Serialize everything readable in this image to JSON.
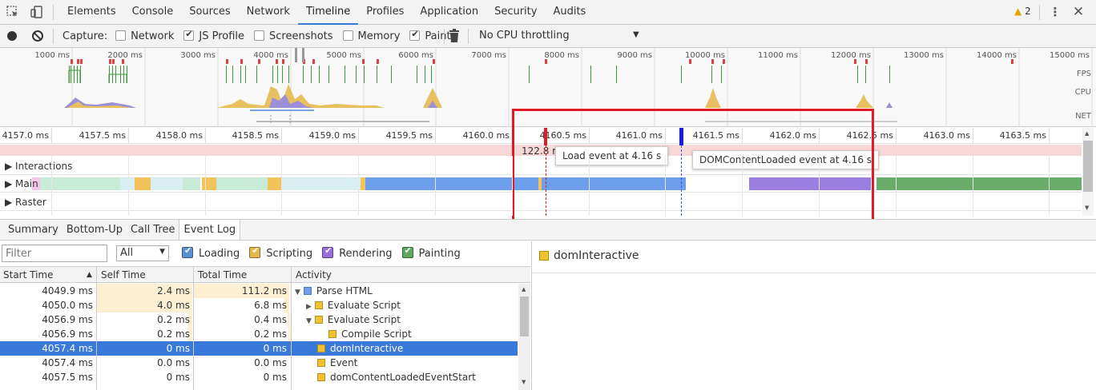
{
  "toolbar": {
    "tabs": [
      "Elements",
      "Console",
      "Sources",
      "Network",
      "Timeline",
      "Profiles",
      "Application",
      "Security",
      "Audits"
    ],
    "active_tab": "Timeline",
    "warning_count": "2"
  },
  "capture": {
    "label": "Capture:",
    "options": [
      {
        "label": "Network",
        "checked": false
      },
      {
        "label": "JS Profile",
        "checked": true
      },
      {
        "label": "Screenshots",
        "checked": false
      },
      {
        "label": "Memory",
        "checked": false
      },
      {
        "label": "Paint",
        "checked": true
      }
    ],
    "throttling": "No CPU throttling"
  },
  "overview": {
    "ticks": [
      "1000 ms",
      "2000 ms",
      "3000 ms",
      "4000 ms",
      "5000 ms",
      "6000 ms",
      "7000 ms",
      "8000 ms",
      "9000 ms",
      "10000 ms",
      "11000 ms",
      "12000 ms",
      "13000 ms",
      "14000 ms",
      "15000 ms"
    ],
    "lanes": [
      "FPS",
      "CPU",
      "NET"
    ]
  },
  "ruler": {
    "ticks": [
      "4157.0 ms",
      "4157.5 ms",
      "4158.0 ms",
      "4158.5 ms",
      "4159.0 ms",
      "4159.5 ms",
      "4160.0 ms",
      "4160.5 ms",
      "4161.0 ms",
      "4161.5 ms",
      "4162.0 ms",
      "4162.5 ms",
      "4163.0 ms",
      "4163.5 ms"
    ]
  },
  "flame": {
    "fragment_label": "122.8 m",
    "tracks": [
      "Interactions",
      "Main",
      "Raster"
    ],
    "load_tooltip": "Load event at 4.16 s",
    "dcl_tooltip": "DOMContentLoaded event at 4.16 s"
  },
  "bottom_tabs": {
    "tabs": [
      "Summary",
      "Bottom-Up",
      "Call Tree",
      "Event Log"
    ],
    "active": "Event Log"
  },
  "filters": {
    "placeholder": "Filter",
    "duration": "All",
    "categories": [
      {
        "label": "Loading",
        "color": "#5b8fd6"
      },
      {
        "label": "Scripting",
        "color": "#e6b84a"
      },
      {
        "label": "Rendering",
        "color": "#9a6fdb"
      },
      {
        "label": "Painting",
        "color": "#5fa760"
      }
    ]
  },
  "table": {
    "headers": [
      "Start Time",
      "Self Time",
      "Total Time",
      "Activity"
    ],
    "rows": [
      {
        "start": "4049.9 ms",
        "self": "2.4 ms",
        "total": "111.2 ms",
        "activity": "Parse HTML",
        "indent": 0,
        "arrow": "▼",
        "color": "#6d9eeb",
        "self_bar": 1.0,
        "total_bar": 1.0
      },
      {
        "start": "4050.0 ms",
        "self": "4.0 ms",
        "total": "6.8 ms",
        "activity": "Evaluate Script",
        "indent": 1,
        "arrow": "▶",
        "color": "#f1c232",
        "self_bar": 1.0,
        "total_bar": 0.06
      },
      {
        "start": "4056.9 ms",
        "self": "0.2 ms",
        "total": "0.4 ms",
        "activity": "Evaluate Script",
        "indent": 1,
        "arrow": "▼",
        "color": "#f1c232",
        "self_bar": 0.05,
        "total_bar": 0.02
      },
      {
        "start": "4056.9 ms",
        "self": "0.2 ms",
        "total": "0.2 ms",
        "activity": "Compile Script",
        "indent": 2,
        "arrow": "",
        "color": "#f1c232",
        "self_bar": 0.05,
        "total_bar": 0.01
      },
      {
        "start": "4057.4 ms",
        "self": "0 ms",
        "total": "0 ms",
        "activity": "domInteractive",
        "indent": 1,
        "arrow": "",
        "color": "#f1c232",
        "self_bar": 0,
        "total_bar": 0
      },
      {
        "start": "4057.4 ms",
        "self": "0.0 ms",
        "total": "0.0 ms",
        "activity": "Event",
        "indent": 1,
        "arrow": "",
        "color": "#f1c232",
        "self_bar": 0,
        "total_bar": 0
      },
      {
        "start": "4057.5 ms",
        "self": "0 ms",
        "total": "0 ms",
        "activity": "domContentLoadedEventStart",
        "indent": 1,
        "arrow": "",
        "color": "#f1c232",
        "self_bar": 0,
        "total_bar": 0
      }
    ],
    "selected_index": 4
  },
  "detail": {
    "title": "domInteractive",
    "color": "#f1c232"
  }
}
